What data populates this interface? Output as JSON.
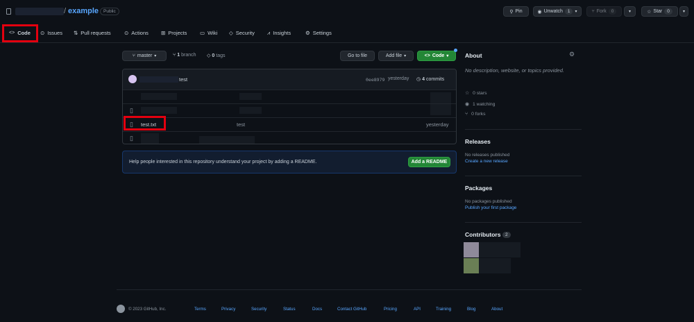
{
  "header": {
    "repo_slash": "/",
    "repo_name": "example",
    "visibility": "Public",
    "pin_label": "Pin",
    "unwatch_label": "Unwatch",
    "unwatch_count": "1",
    "fork_label": "Fork",
    "fork_count": "0",
    "star_label": "Star",
    "star_count": "0"
  },
  "nav": {
    "code": "Code",
    "issues": "Issues",
    "pulls": "Pull requests",
    "actions": "Actions",
    "projects": "Projects",
    "wiki": "Wiki",
    "security": "Security",
    "insights": "Insights",
    "settings": "Settings"
  },
  "toolbar": {
    "branch": "master",
    "branch_count": "1",
    "branch_word": "branch",
    "tag_count": "0",
    "tag_word": "tags",
    "goto_file": "Go to file",
    "add_file": "Add file",
    "code_btn": "Code"
  },
  "commit": {
    "message": "test",
    "hash": "0ee8979",
    "time": "yesterday",
    "count": "4",
    "count_word": "commits"
  },
  "files": [
    {
      "name": "test.txt",
      "message": "test",
      "time": "yesterday"
    }
  ],
  "readme_banner": {
    "text": "Help people interested in this repository understand your project by adding a README.",
    "button": "Add a README"
  },
  "about": {
    "title": "About",
    "description": "No description, website, or topics provided.",
    "stars": "0 stars",
    "watching": "1 watching",
    "forks": "0 forks"
  },
  "releases": {
    "title": "Releases",
    "none": "No releases published",
    "create": "Create a new release"
  },
  "packages": {
    "title": "Packages",
    "none": "No packages published",
    "publish": "Publish your first package"
  },
  "contributors": {
    "title": "Contributors",
    "count": "2"
  },
  "footer": {
    "copyright": "© 2023 GitHub, Inc.",
    "links": [
      "Terms",
      "Privacy",
      "Security",
      "Status",
      "Docs",
      "Contact GitHub",
      "Pricing",
      "API",
      "Training",
      "Blog",
      "About"
    ]
  },
  "colors": {
    "background": "#0d1117",
    "accent": "#58a6ff",
    "green": "#238636",
    "highlight": "#e3000f"
  }
}
